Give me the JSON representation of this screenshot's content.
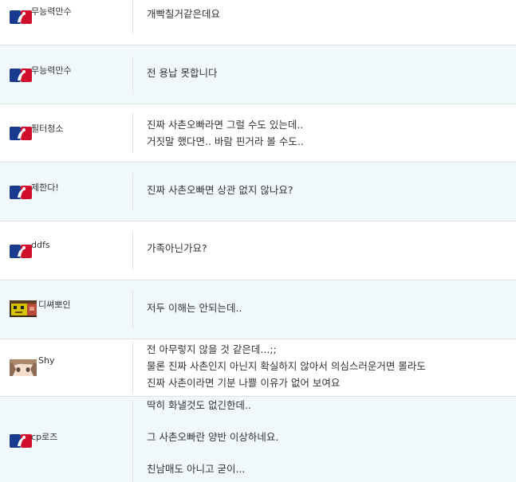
{
  "comments": [
    {
      "nickname": "무능력만수",
      "badge": "mlb-logo-icon",
      "lines": [
        "개빡칠거같은데요"
      ]
    },
    {
      "nickname": "무능력만수",
      "badge": "mlb-logo-icon",
      "lines": [
        "전 용납 못합니다"
      ]
    },
    {
      "nickname": "필터청소",
      "badge": "mlb-logo-icon",
      "lines": [
        "진짜 사촌오빠라면 그럴 수도 있는데..",
        "거짓말 했다면.. 바람 핀거라 볼 수도.."
      ]
    },
    {
      "nickname": "제한다!",
      "badge": "mlb-logo-icon",
      "lines": [
        "진짜 사촌오빠면 상관 없지 않나요?"
      ]
    },
    {
      "nickname": "ddfs",
      "badge": "mlb-logo-icon",
      "lines": [
        "가족아닌가요?"
      ]
    },
    {
      "nickname": "디쎠뽀인",
      "badge": "pixel-avatar-icon",
      "lines": [
        "저두 이해는 안되는데.."
      ]
    },
    {
      "nickname": "Shy",
      "badge": "anime-avatar-icon",
      "lines": [
        "전 아무렇지 않을 것 같은데...;;",
        "물론 진짜 사촌인지 아닌지 확실하지 않아서 의심스러운거면 몰라도",
        "진짜 사촌이라면 기분 나쁠 이유가 없어 보여요"
      ]
    },
    {
      "nickname": "cp로즈",
      "badge": "mlb-logo-icon",
      "lines": [
        "딱히 화낼것도 없긴한데..",
        "",
        "그 사촌오빠란 양반 이상하네요.",
        "",
        "친남매도 아니고 굳이..."
      ]
    }
  ],
  "colors": {
    "row_alt": "#f1f8fb",
    "mlb_blue": "#1a3a8f",
    "mlb_red": "#d0102a"
  }
}
